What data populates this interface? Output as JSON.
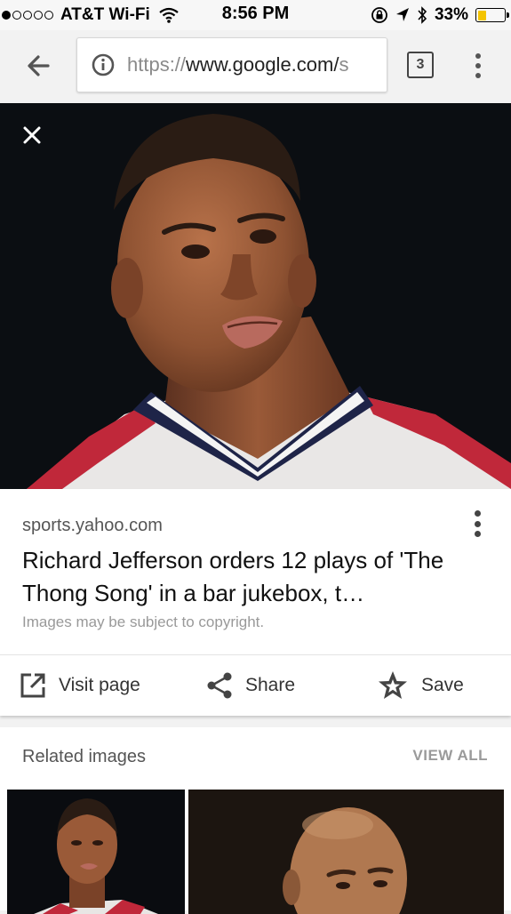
{
  "status_bar": {
    "carrier": "AT&T Wi-Fi",
    "time": "8:56 PM",
    "battery_percent": "33%",
    "battery_level": 0.33,
    "battery_color": "#f4c400"
  },
  "toolbar": {
    "url_scheme": "https://",
    "url_host": "www.google.com/",
    "url_fade": "s",
    "tab_count": "3"
  },
  "result": {
    "source": "sports.yahoo.com",
    "title": "Richard Jefferson orders 12 plays of 'The Thong Song' in a bar jukebox, t…",
    "copyright": "Images may be subject to copyright.",
    "visit_label": "Visit page",
    "share_label": "Share",
    "save_label": "Save"
  },
  "related": {
    "title": "Related images",
    "view_all": "VIEW ALL"
  },
  "colors": {
    "hero_background": "#0b0e12",
    "jersey_red": "#c0283a",
    "jersey_navy": "#1e2448"
  },
  "icons": [
    "info-icon",
    "back-arrow-icon",
    "tabs-icon",
    "menu-icon",
    "close-icon",
    "open-in-new-icon",
    "share-icon",
    "star-icon",
    "more-vert-icon"
  ]
}
